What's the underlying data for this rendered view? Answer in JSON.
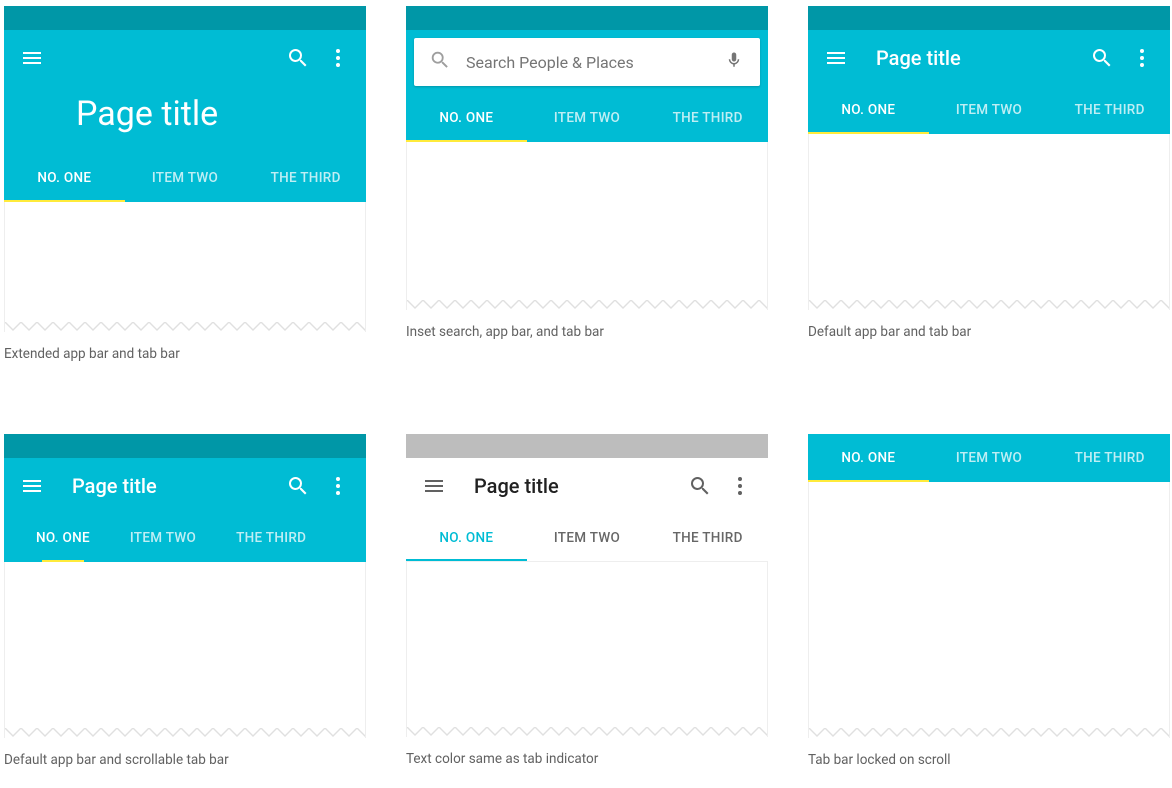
{
  "colors": {
    "primary": "#00bcd4",
    "primaryDark": "#0097a7",
    "accent": "#ffeb3b"
  },
  "tabs": [
    "NO. ONE",
    "ITEM TWO",
    "THE THIRD"
  ],
  "page_title": "Page title",
  "search_placeholder": "Search People  & Places",
  "captions": {
    "c1": "Extended app bar and tab bar",
    "c2": "Inset search, app bar, and tab bar",
    "c3": "Default app bar and tab bar",
    "c4": "Default app bar and scrollable tab bar",
    "c5": "Text color same as tab indicator",
    "c6": "Tab bar locked on scroll"
  }
}
